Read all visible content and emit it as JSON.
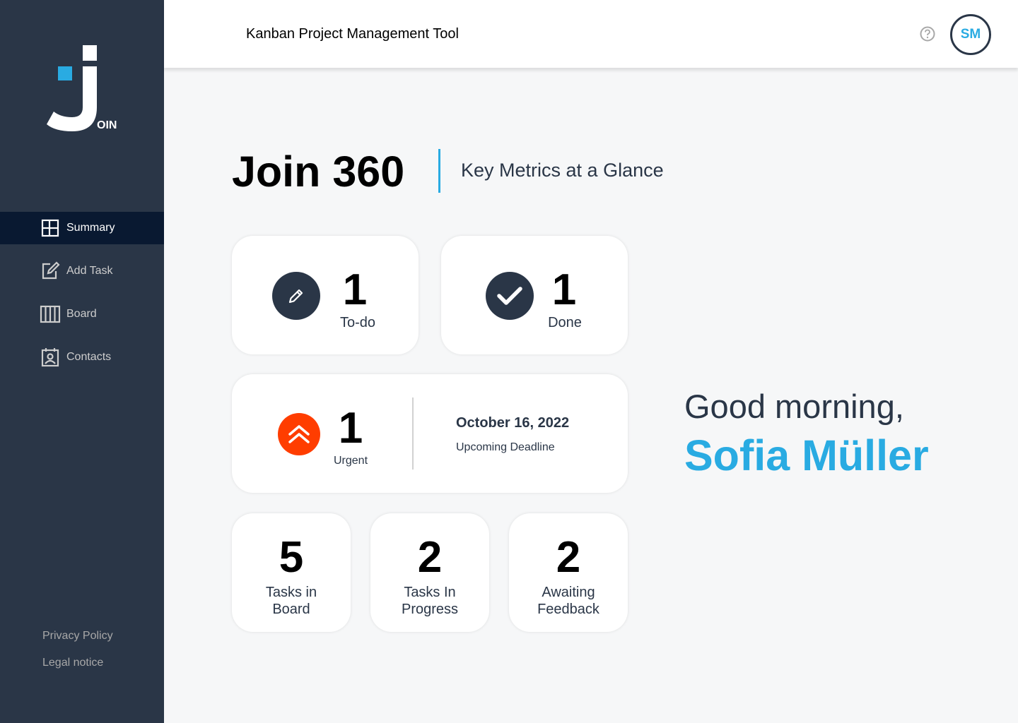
{
  "app": {
    "logo_text": "OIN"
  },
  "sidebar": {
    "items": [
      {
        "label": "Summary",
        "icon": "summary-icon",
        "active": true
      },
      {
        "label": "Add Task",
        "icon": "add-task-icon",
        "active": false
      },
      {
        "label": "Board",
        "icon": "board-icon",
        "active": false
      },
      {
        "label": "Contacts",
        "icon": "contacts-icon",
        "active": false
      }
    ],
    "privacy_policy": "Privacy Policy",
    "legal_notice": "Legal notice"
  },
  "header": {
    "title": "Kanban Project Management Tool",
    "help_icon": "help-icon",
    "avatar_initials": "SM"
  },
  "page": {
    "title": "Join 360",
    "subtitle": "Key Metrics at a Glance"
  },
  "metrics": {
    "todo": {
      "value": "1",
      "label": "To-do",
      "icon": "pencil-icon"
    },
    "done": {
      "value": "1",
      "label": "Done",
      "icon": "check-icon"
    },
    "urgent": {
      "value": "1",
      "label": "Urgent",
      "icon": "double-chevron-up-icon"
    },
    "deadline": {
      "date": "October 16, 2022",
      "label": "Upcoming Deadline"
    },
    "tasks_in_board": {
      "value": "5",
      "label_line1": "Tasks in",
      "label_line2": "Board"
    },
    "tasks_in_progress": {
      "value": "2",
      "label_line1": "Tasks In",
      "label_line2": "Progress"
    },
    "awaiting_feedback": {
      "value": "2",
      "label_line1": "Awaiting",
      "label_line2": "Feedback"
    }
  },
  "greeting": {
    "text": "Good morning,",
    "name": "Sofia Müller"
  },
  "colors": {
    "sidebar_bg": "#2A3647",
    "active_nav_bg": "#091931",
    "accent_blue": "#29ABE2",
    "urgent_orange": "#FF3D00",
    "page_bg": "#F6F7F8"
  }
}
